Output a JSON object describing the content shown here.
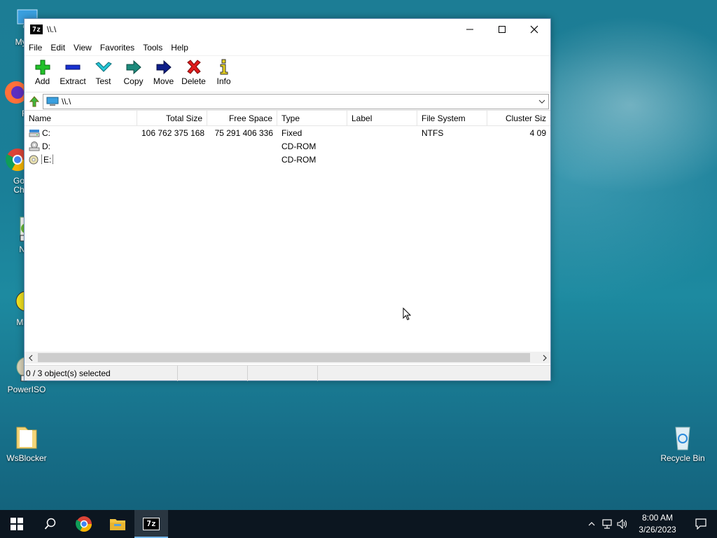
{
  "desktop": {
    "icons": [
      {
        "label": "My Co"
      },
      {
        "label": "Fi"
      },
      {
        "label": "Go Ch"
      },
      {
        "label": "Note"
      },
      {
        "label": "MsLo"
      },
      {
        "label": "PowerISO"
      },
      {
        "label": "WsBlocker"
      },
      {
        "label": "Recycle Bin"
      }
    ]
  },
  "window": {
    "app_icon_text": "7z",
    "title": "\\\\.\\",
    "menu": [
      "File",
      "Edit",
      "View",
      "Favorites",
      "Tools",
      "Help"
    ],
    "toolbar": [
      {
        "label": "Add",
        "icon": "plus-icon"
      },
      {
        "label": "Extract",
        "icon": "minus-icon"
      },
      {
        "label": "Test",
        "icon": "check-icon"
      },
      {
        "label": "Copy",
        "icon": "copy-arrow-icon"
      },
      {
        "label": "Move",
        "icon": "move-arrow-icon"
      },
      {
        "label": "Delete",
        "icon": "delete-x-icon"
      },
      {
        "label": "Info",
        "icon": "info-icon"
      }
    ],
    "address": "\\\\.\\",
    "columns": [
      "Name",
      "Total Size",
      "Free Space",
      "Type",
      "Label",
      "File System",
      "Cluster Siz"
    ],
    "rows": [
      {
        "name": "C:",
        "total": "106 762 375 168",
        "free": "75 291 406 336",
        "type": "Fixed",
        "label": "",
        "fs": "NTFS",
        "cluster": "4 09",
        "icon": "hard-drive-icon"
      },
      {
        "name": "D:",
        "total": "",
        "free": "",
        "type": "CD-ROM",
        "label": "",
        "fs": "",
        "cluster": "",
        "icon": "cd-rom-icon"
      },
      {
        "name": "E:",
        "total": "",
        "free": "",
        "type": "CD-ROM",
        "label": "",
        "fs": "",
        "cluster": "",
        "icon": "cd-rom-icon"
      }
    ],
    "status": [
      "0 / 3 object(s) selected",
      "",
      "",
      ""
    ]
  },
  "taskbar": {
    "time": "8:00 AM",
    "date": "3/26/2023",
    "active_app_text": "7z"
  }
}
